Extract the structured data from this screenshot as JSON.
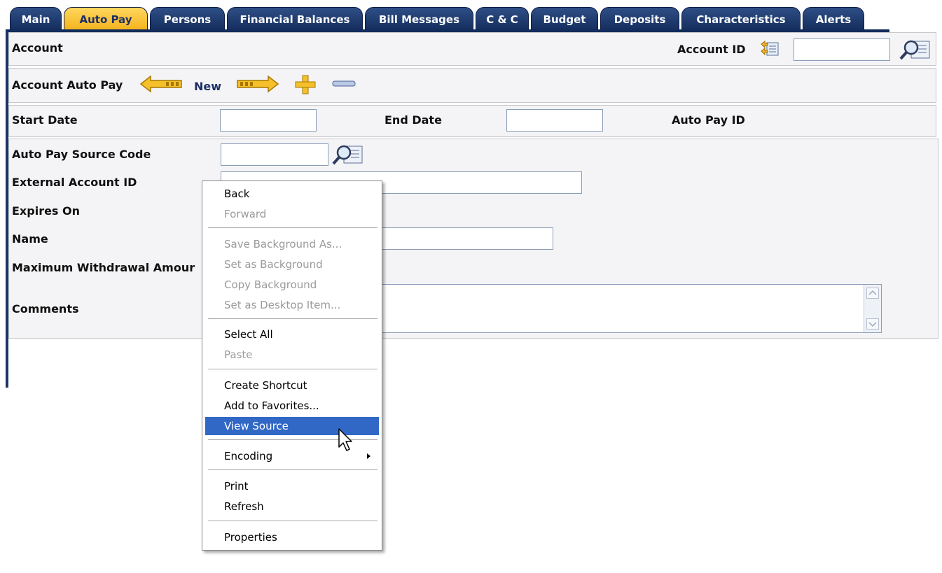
{
  "tabs": [
    {
      "label": "Main",
      "active": false
    },
    {
      "label": "Auto Pay",
      "active": true
    },
    {
      "label": "Persons",
      "active": false
    },
    {
      "label": "Financial Balances",
      "active": false
    },
    {
      "label": "Bill Messages",
      "active": false
    },
    {
      "label": "C & C",
      "active": false
    },
    {
      "label": "Budget",
      "active": false
    },
    {
      "label": "Deposits",
      "active": false
    },
    {
      "label": "Characteristics",
      "active": false
    },
    {
      "label": "Alerts",
      "active": false
    }
  ],
  "account": {
    "label": "Account",
    "id_label": "Account ID",
    "id_value": ""
  },
  "autopay": {
    "label": "Account Auto Pay",
    "new_label": "New"
  },
  "dates": {
    "start_label": "Start Date",
    "start_value": "",
    "end_label": "End Date",
    "end_value": "",
    "autopay_id_label": "Auto Pay ID"
  },
  "form": {
    "source_code_label": "Auto Pay Source Code",
    "source_code_value": "",
    "external_account_label": "External Account ID",
    "external_account_value": "",
    "expires_label": "Expires On",
    "name_label": "Name",
    "name_value": "",
    "max_withdrawal_label": "Maximum Withdrawal Amour",
    "comments_label": "Comments",
    "comments_value": ""
  },
  "context_menu": {
    "items": [
      {
        "label": "Back",
        "enabled": true
      },
      {
        "label": "Forward",
        "enabled": false
      },
      {
        "label": "Save Background As...",
        "enabled": false
      },
      {
        "label": "Set as Background",
        "enabled": false
      },
      {
        "label": "Copy Background",
        "enabled": false
      },
      {
        "label": "Set as Desktop Item...",
        "enabled": false
      },
      {
        "label": "Select All",
        "enabled": true
      },
      {
        "label": "Paste",
        "enabled": false
      },
      {
        "label": "Create Shortcut",
        "enabled": true
      },
      {
        "label": "Add to Favorites...",
        "enabled": true
      },
      {
        "label": "View Source",
        "enabled": true,
        "highlighted": true
      },
      {
        "label": "Encoding",
        "enabled": true,
        "submenu": true
      },
      {
        "label": "Print",
        "enabled": true
      },
      {
        "label": "Refresh",
        "enabled": true
      },
      {
        "label": "Properties",
        "enabled": true
      }
    ]
  },
  "colors": {
    "tab_dark": "#132c5c",
    "tab_active": "#f3b21b",
    "menu_highlight": "#3168c6",
    "panel_bg": "#f4f4f6"
  },
  "icons": [
    "search-icon",
    "account-context-icon",
    "previous-arrow-icon",
    "next-arrow-icon",
    "add-plus-icon",
    "remove-minus-icon",
    "scroll-up-icon",
    "scroll-down-icon",
    "mouse-cursor-icon",
    "submenu-arrow-icon"
  ]
}
